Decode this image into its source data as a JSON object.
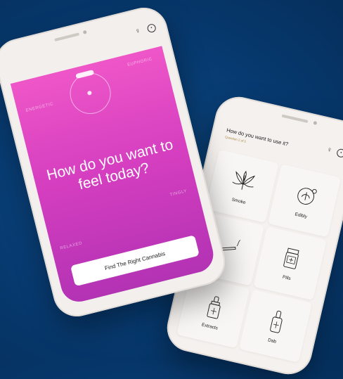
{
  "front": {
    "headline": "How do you want to feel today?",
    "moods": {
      "energetic": "ENERGETIC",
      "euphoric": "EUPHORIC",
      "relaxed": "RELAXED",
      "tingly": "TINGLY"
    },
    "cta_label": "Find The Right Cannabis",
    "icons": [
      "user-icon",
      "settings-icon"
    ],
    "gradient_colors": [
      "#ee56c8",
      "#b332b4"
    ]
  },
  "back": {
    "title": "How do you want to use it?",
    "subtitle": "Question 2 of 5",
    "icons": [
      "user-icon",
      "settings-icon"
    ],
    "options": [
      {
        "label": "Smoke",
        "icon": "leaf-icon"
      },
      {
        "label": "Edibly",
        "icon": "edible-icon"
      },
      {
        "label": "",
        "icon": "joint-icon"
      },
      {
        "label": "Pills",
        "icon": "pill-bottle-icon"
      },
      {
        "label": "Extracts",
        "icon": "dropper-icon"
      },
      {
        "label": "Dab",
        "icon": "dab-icon"
      }
    ]
  },
  "background_color": "#073a70"
}
